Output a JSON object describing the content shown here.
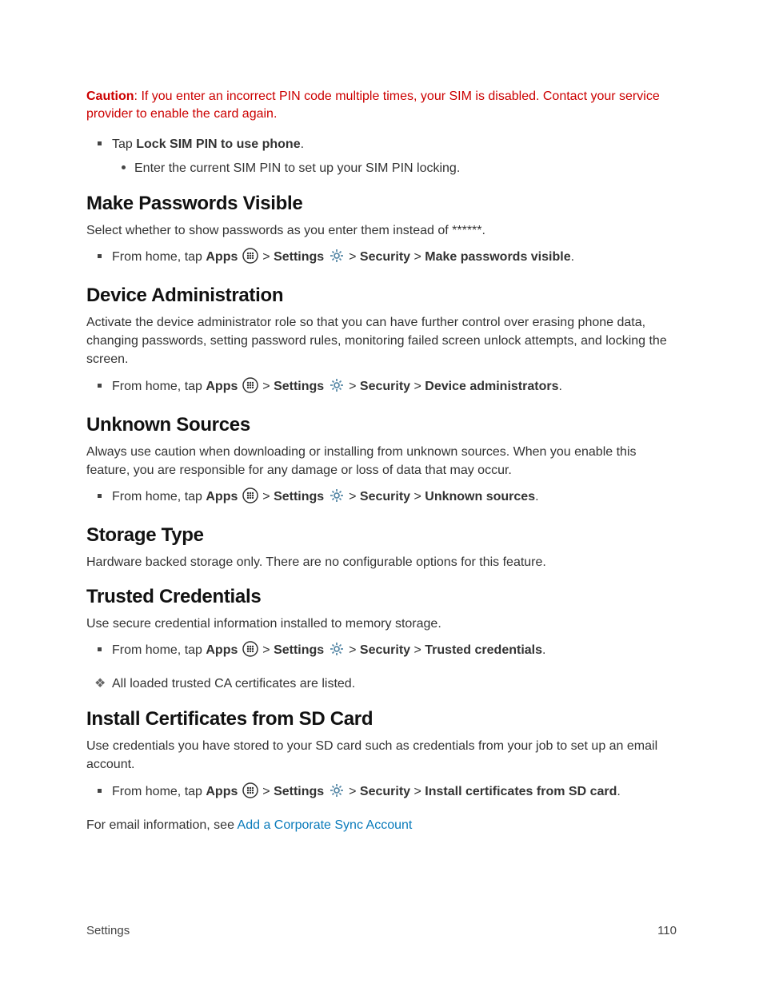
{
  "caution": {
    "label": "Caution",
    "text": ": If you enter an incorrect PIN code multiple times, your SIM is disabled. Contact your service provider to enable the card again."
  },
  "sim": {
    "tap_prefix": "Tap ",
    "tap_bold": "Lock SIM PIN to use phone",
    "tap_suffix": ".",
    "sub": "Enter the current SIM PIN to set up your SIM PIN locking."
  },
  "passwords": {
    "heading": "Make Passwords Visible",
    "body": "Select whether to show passwords as you enter them instead of ******.",
    "path_last": "Make passwords visible"
  },
  "admin": {
    "heading": "Device Administration",
    "body": "Activate the device administrator role so that you can have further control over erasing phone data, changing passwords, setting password rules, monitoring failed screen unlock attempts, and locking the screen.",
    "path_last": "Device administrators"
  },
  "unknown": {
    "heading": "Unknown Sources",
    "body": "Always use caution when downloading or installing from unknown sources. When you enable this feature, you are responsible for any damage or loss of data that may occur.",
    "path_last": "Unknown sources"
  },
  "storage": {
    "heading": "Storage Type",
    "body": "Hardware backed storage only. There are no configurable options for this feature."
  },
  "trusted": {
    "heading": "Trusted Credentials",
    "body": "Use secure credential information installed to memory storage.",
    "path_last": "Trusted credentials",
    "note": "All loaded trusted CA certificates are listed."
  },
  "install": {
    "heading": "Install Certificates from SD Card",
    "body": "Use credentials you have stored to your SD card such as credentials from your job to set up an email account.",
    "path_last": "Install certificates from SD card",
    "after_prefix": "For email information, see ",
    "after_link": "Add a Corporate Sync Account"
  },
  "path": {
    "from_home": "From home, tap ",
    "apps": "Apps",
    "settings": "Settings",
    "security": "Security",
    "sep": " > "
  },
  "footer": {
    "left": "Settings",
    "right": "110"
  }
}
